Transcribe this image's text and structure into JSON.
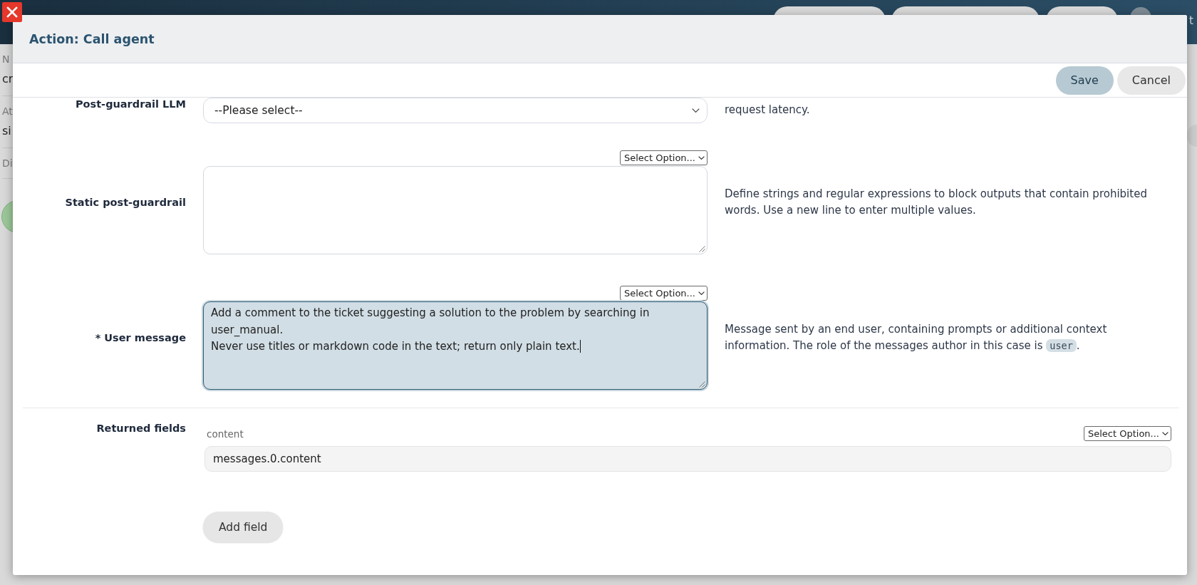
{
  "background": {
    "user_name": "t",
    "sections": [
      {
        "label": "N",
        "value": "cr"
      },
      {
        "label": "At",
        "value": "si"
      },
      {
        "label": "Di"
      }
    ]
  },
  "dialog": {
    "title": "Action: Call agent",
    "buttons": [
      {
        "label": "Save",
        "kind": "primary"
      },
      {
        "label": "Cancel",
        "kind": "secondary"
      }
    ]
  },
  "fields": [
    {
      "kind": "select",
      "label": "Post-guardrail LLM",
      "value": "--Please select--",
      "description": [
        {
          "kind": "text",
          "text": "request latency."
        }
      ]
    },
    {
      "kind": "textarea",
      "label": "Static post-guardrail",
      "option_picker": "Select Option...",
      "focused": false,
      "description": [
        {
          "kind": "text",
          "text": "Define strings and regular expressions to block outputs that contain prohibited words. Use a new line to enter multiple values."
        }
      ]
    },
    {
      "kind": "textarea",
      "label": "* User message",
      "option_picker": "Select Option...",
      "focused": true,
      "value": "Add a comment to the ticket suggesting a solution to the problem by searching in user_manual.\nNever use titles or markdown code in the text; return only plain text.",
      "description": [
        {
          "kind": "text",
          "text": "Message sent by an end user, containing prompts or additional context information. The role of the messages author in this case is "
        },
        {
          "kind": "code",
          "text": "user"
        },
        {
          "kind": "text",
          "text": "."
        }
      ]
    }
  ],
  "returned_fields": {
    "label": "Returned fields",
    "items": [
      {
        "name": "content",
        "option_picker": "Select Option...",
        "value": "messages.0.content"
      }
    ],
    "add_button": "Add field"
  }
}
